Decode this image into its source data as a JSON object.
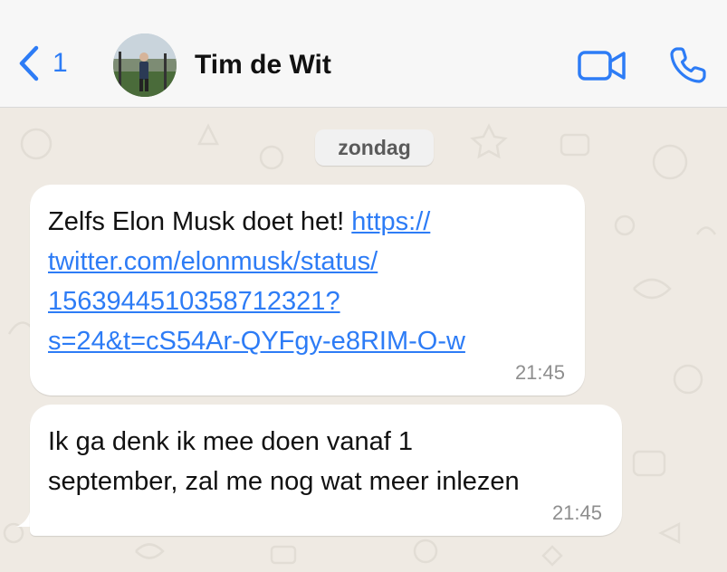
{
  "header": {
    "back_count": "1",
    "contact_name": "Tim de Wit",
    "icons": {
      "back": "chevron-left-icon",
      "video": "video-camera-icon",
      "phone": "phone-icon"
    },
    "accent_color": "#2d7cf6"
  },
  "chat": {
    "date_label": "zondag",
    "messages": [
      {
        "text": "Zelfs Elon Musk doet het!",
        "link_lines": [
          "https://",
          "twitter.com/elonmusk/status/",
          "1563944510358712321?",
          "s=24&t=cS54Ar-QYFgy-e8RIM-O-w"
        ],
        "time": "21:45"
      },
      {
        "lines": [
          "Ik ga denk ik mee doen vanaf 1",
          "september, zal me nog wat meer inlezen"
        ],
        "time": "21:45"
      }
    ]
  }
}
